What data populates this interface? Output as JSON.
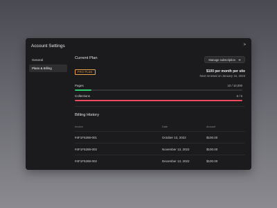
{
  "modal": {
    "title": "Account Settings",
    "close_label": ">"
  },
  "sidebar": {
    "items": [
      {
        "label": "General",
        "active": false
      },
      {
        "label": "Plans & Billing",
        "active": true
      }
    ]
  },
  "current_plan": {
    "title": "Current Plan",
    "manage_label": "Manage subscription",
    "manage_icon": "arrow-icon",
    "badge": "PRO PLAN",
    "price": "$100 per month per site",
    "renewal": "Next renewal on January 16, 2023",
    "usage": [
      {
        "label": "Pages",
        "value": "10 / 10,000",
        "fraction": 0.1,
        "color": "#2ecc71"
      },
      {
        "label": "Collections",
        "value": "6 / 6",
        "fraction": 1.0,
        "color": "#f04a5e"
      }
    ]
  },
  "billing": {
    "title": "Billing History",
    "columns": [
      "Invoice",
      "Date",
      "Amount"
    ],
    "rows": [
      [
        "#4F1F5288-001",
        "October 13, 2022",
        "$100.00"
      ],
      [
        "#4F1F5288-002",
        "November 13, 2022",
        "$100.00"
      ],
      [
        "#4F1F5288-002",
        "December 13, 2022",
        "$100.00"
      ]
    ]
  }
}
